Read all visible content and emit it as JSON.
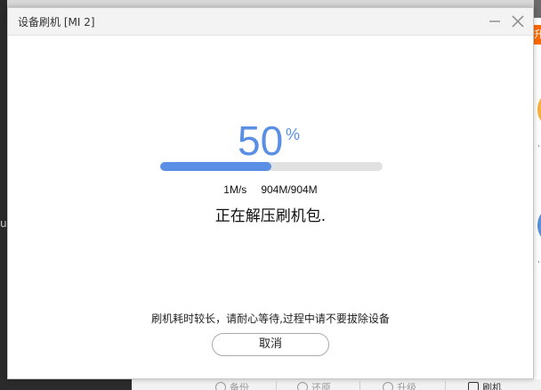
{
  "background_app": {
    "left_glyph": "u",
    "right_tab_glyph": "升",
    "bottom_bar": {
      "items": [
        {
          "label": "备份",
          "icon": "backup-icon"
        },
        {
          "label": "还原",
          "icon": "restore-icon"
        },
        {
          "label": "升级",
          "icon": "upgrade-icon"
        },
        {
          "label": "刷机",
          "icon": "flash-icon",
          "active": true
        }
      ]
    }
  },
  "dialog": {
    "title": "设备刷机 [MI 2]",
    "window_controls": {
      "minimize_icon": "minimize-icon",
      "close_icon": "close-icon"
    },
    "progress": {
      "percent_value": "50",
      "percent_sign": "%",
      "fraction": 0.5
    },
    "stats": {
      "speed": "1M/s",
      "size": "904M/904M"
    },
    "status_text": "正在解压刷机包.",
    "warning_text": "刷机耗时较长，请耐心等待,过程中请不要拔除设备",
    "cancel_label": "取消"
  },
  "colors": {
    "accent": "#5b8fe6",
    "track": "#e1e1e1",
    "titlebar": "#f3f3f3",
    "orange": "#ff6a00"
  }
}
